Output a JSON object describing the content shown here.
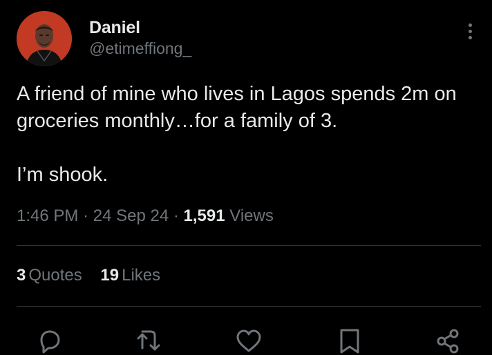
{
  "author": {
    "display_name": "Daniel",
    "handle": "@etimeffiong_",
    "avatar": "profile-photo"
  },
  "tweet": {
    "paragraphs": [
      "A friend of mine who lives in Lagos spends 2m on groceries monthly…for a family of 3.",
      "I’m shook."
    ],
    "time": "1:46 PM",
    "date": "24 Sep 24",
    "separator": "·",
    "views_count": "1,591",
    "views_label": "Views"
  },
  "stats": {
    "quotes_count": "3",
    "quotes_label": "Quotes",
    "likes_count": "19",
    "likes_label": "Likes"
  },
  "actions": {
    "icons": [
      "reply-icon",
      "retweet-icon",
      "like-icon",
      "bookmark-icon",
      "share-icon"
    ]
  },
  "colors": {
    "background": "#000000",
    "text_primary": "#e7e9ea",
    "text_secondary": "#71767b",
    "divider": "#2f3336"
  }
}
